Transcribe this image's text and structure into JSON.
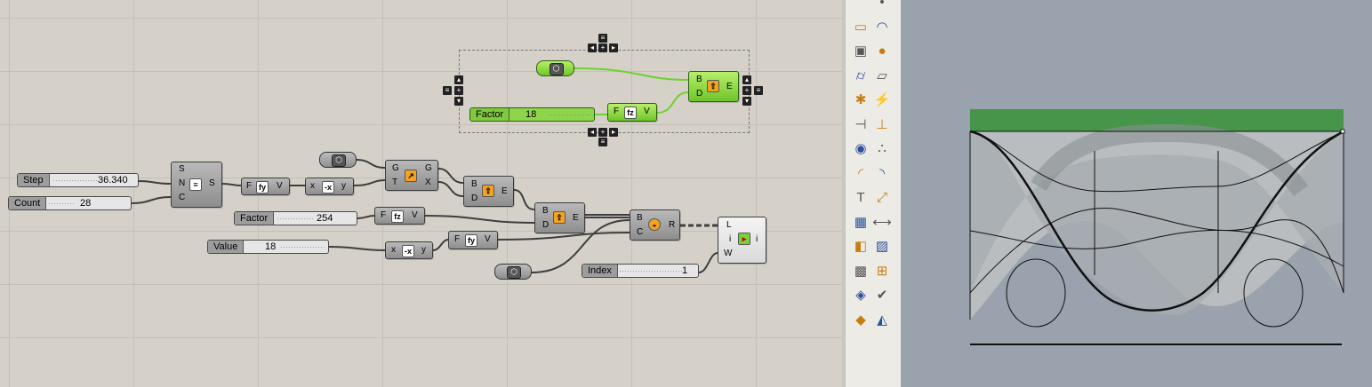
{
  "sliders": {
    "step": {
      "name": "Step",
      "value": "36.340"
    },
    "count": {
      "name": "Count",
      "value": "28"
    },
    "factor_main": {
      "name": "Factor",
      "value": "254"
    },
    "value": {
      "name": "Value",
      "value": "18"
    },
    "index": {
      "name": "Index",
      "value": "1"
    },
    "factor_group": {
      "name": "Factor",
      "value": "18"
    }
  },
  "components": {
    "series": {
      "inputs": [
        "S",
        "N",
        "C"
      ],
      "output": "S"
    },
    "expr1": {
      "input": "F",
      "output": "V",
      "icon": "fy"
    },
    "negative": {
      "input": "x",
      "output": "y",
      "icon": "-x"
    },
    "vector": {
      "inputs": [
        "G",
        "T"
      ],
      "outputs": [
        "G",
        "X"
      ]
    },
    "graft1": {
      "inputs": [
        "B",
        "D"
      ],
      "output": "E"
    },
    "expr2": {
      "input": "F",
      "output": "V",
      "icon": "fz"
    },
    "negative2": {
      "input": "x",
      "output": "y",
      "icon": "-x"
    },
    "expr3": {
      "input": "F",
      "output": "V",
      "icon": "fy"
    },
    "graft2": {
      "inputs": [
        "B",
        "D"
      ],
      "output": "E"
    },
    "brep": {
      "inputs": [
        "B",
        "C"
      ],
      "output": "R"
    },
    "list_item": {
      "inputs": [
        "L",
        "i",
        "W"
      ],
      "output": "i"
    },
    "group_expr": {
      "input": "F",
      "output": "V",
      "icon": "fz"
    },
    "group_graft": {
      "inputs": [
        "B",
        "D"
      ],
      "output": "E"
    }
  },
  "colors": {
    "canvas": "#d5d1c9",
    "selected": "#8fd54b",
    "viewport": "#9aa3ad",
    "bar": "#46954a"
  },
  "toolbar_icons": [
    "curve-icon",
    "point-icon",
    "rectangle-icon",
    "arc-icon",
    "box-icon",
    "sphere-icon",
    "cylinder-icon",
    "plane-surface-icon",
    "gear-icon",
    "lightning-icon",
    "trim-icon",
    "split-icon",
    "boolean-icon",
    "points-icon",
    "fillet-icon",
    "blend-icon",
    "text-icon",
    "scale-icon",
    "array-icon",
    "dimension-icon",
    "block-icon",
    "hatch-icon",
    "grid-icon",
    "analyze-icon",
    "render-icon",
    "check-icon",
    "solid-icon",
    "light-icon"
  ]
}
